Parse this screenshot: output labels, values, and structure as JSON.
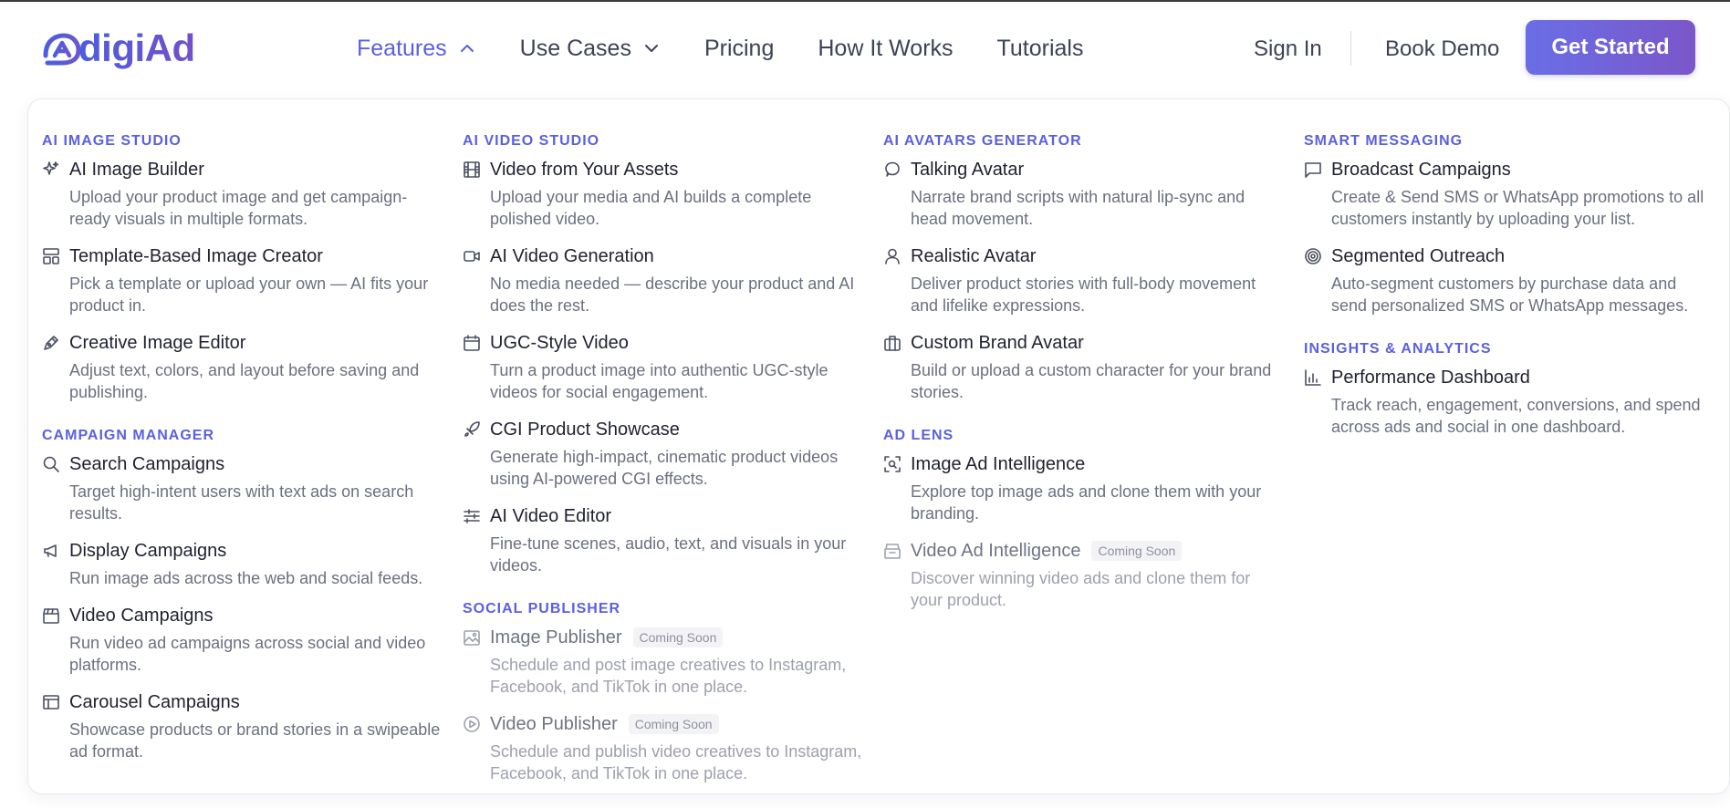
{
  "brand": {
    "name": "digiAd",
    "color": "#5b60e0"
  },
  "nav": {
    "features": "Features",
    "use_cases": "Use Cases",
    "pricing": "Pricing",
    "how_it_works": "How It Works",
    "tutorials": "Tutorials"
  },
  "actions": {
    "sign_in": "Sign In",
    "book_demo": "Book Demo",
    "get_started": "Get Started"
  },
  "badge_text": "Coming Soon",
  "menu": {
    "image_studio": {
      "title": "AI IMAGE STUDIO",
      "items": [
        {
          "icon": "sparkle-icon",
          "title": "AI Image Builder",
          "desc": "Upload your product image and get campaign-ready visuals in multiple formats."
        },
        {
          "icon": "template-icon",
          "title": "Template-Based Image Creator",
          "desc": "Pick a template or upload your own — AI fits your product in."
        },
        {
          "icon": "pen-icon",
          "title": "Creative Image Editor",
          "desc": "Adjust text, colors, and layout before saving and publishing."
        }
      ]
    },
    "campaign_manager": {
      "title": "CAMPAIGN MANAGER",
      "items": [
        {
          "icon": "search-icon",
          "title": "Search Campaigns",
          "desc": "Target high-intent users with text ads on search results."
        },
        {
          "icon": "megaphone-icon",
          "title": "Display Campaigns",
          "desc": "Run image ads across the web and social feeds."
        },
        {
          "icon": "clapperboard-icon",
          "title": "Video Campaigns",
          "desc": "Run video ad campaigns across social and video platforms."
        },
        {
          "icon": "carousel-icon",
          "title": "Carousel Campaigns",
          "desc": "Showcase products or brand stories in a swipeable ad format."
        }
      ]
    },
    "video_studio": {
      "title": "AI VIDEO STUDIO",
      "items": [
        {
          "icon": "film-icon",
          "title": "Video from Your Assets",
          "desc": "Upload your media and AI builds a complete polished video."
        },
        {
          "icon": "video-camera-icon",
          "title": "AI Video Generation",
          "desc": "No media needed — describe your product and AI does the rest."
        },
        {
          "icon": "calendar-icon",
          "title": "UGC-Style Video",
          "desc": "Turn a product image into authentic UGC-style videos for social engagement."
        },
        {
          "icon": "rocket-icon",
          "title": "CGI Product Showcase",
          "desc": "Generate high-impact, cinematic product videos using AI-powered CGI effects."
        },
        {
          "icon": "sliders-icon",
          "title": "AI Video Editor",
          "desc": "Fine-tune scenes, audio, text, and visuals in your videos."
        }
      ]
    },
    "social_publisher": {
      "title": "SOCIAL PUBLISHER",
      "items": [
        {
          "icon": "image-plus-icon",
          "title": "Image Publisher",
          "desc": "Schedule and post image creatives to Instagram, Facebook, and TikTok in one place."
        },
        {
          "icon": "play-circle-icon",
          "title": "Video Publisher",
          "desc": "Schedule and publish video creatives to Instagram, Facebook, and TikTok in one place."
        }
      ]
    },
    "avatars": {
      "title": "AI AVATARS GENERATOR",
      "items": [
        {
          "icon": "speech-bubble-icon",
          "title": "Talking Avatar",
          "desc": "Narrate brand scripts with natural lip-sync and head movement."
        },
        {
          "icon": "user-icon",
          "title": "Realistic Avatar",
          "desc": "Deliver product stories with full-body movement and lifelike expressions."
        },
        {
          "icon": "briefcase-icon",
          "title": "Custom Brand Avatar",
          "desc": "Build or upload a custom character for your brand stories."
        }
      ]
    },
    "ad_lens": {
      "title": "AD LENS",
      "items": [
        {
          "icon": "scan-icon",
          "title": "Image Ad Intelligence",
          "desc": "Explore top image ads and clone them with your branding."
        },
        {
          "icon": "archive-icon",
          "title": "Video Ad Intelligence",
          "desc": "Discover winning video ads and clone them for your product."
        }
      ]
    },
    "smart_messaging": {
      "title": "SMART MESSAGING",
      "items": [
        {
          "icon": "message-square-icon",
          "title": "Broadcast Campaigns",
          "desc": "Create & Send SMS or WhatsApp promotions to all customers instantly by uploading your list."
        },
        {
          "icon": "target-icon",
          "title": "Segmented Outreach",
          "desc": "Auto-segment customers by purchase data and send personalized SMS or WhatsApp messages."
        }
      ]
    },
    "insights": {
      "title": "INSIGHTS & ANALYTICS",
      "items": [
        {
          "icon": "bar-chart-icon",
          "title": "Performance Dashboard",
          "desc": "Track reach, engagement, conversions, and spend across ads and social in one dashboard."
        }
      ]
    }
  }
}
